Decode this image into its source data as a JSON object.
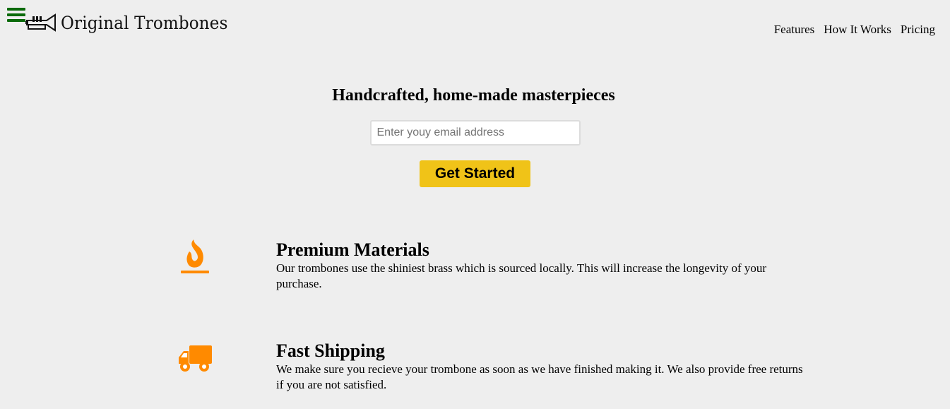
{
  "header": {
    "brand": "Original Trombones",
    "logo_icon": "trumpet-icon",
    "menu_icon": "hamburger-menu-icon",
    "nav": [
      {
        "label": "Features"
      },
      {
        "label": "How It Works"
      },
      {
        "label": "Pricing"
      }
    ]
  },
  "hero": {
    "heading": "Handcrafted, home-made masterpieces",
    "email_placeholder": "Enter youy email address",
    "email_value": "",
    "cta_label": "Get Started"
  },
  "features": [
    {
      "icon": "fire-icon",
      "title": "Premium Materials",
      "description": "Our trombones use the shiniest brass which is sourced locally. This will increase the longevity of your purchase."
    },
    {
      "icon": "truck-icon",
      "title": "Fast Shipping",
      "description": "We make sure you recieve your trombone as soon as we have finished making it. We also provide free returns if you are not satisfied."
    }
  ],
  "colors": {
    "background": "#eeeeee",
    "accent_button": "#f0c318",
    "icon_orange": "#ff8a00",
    "menu_green": "#0a6a0a"
  }
}
